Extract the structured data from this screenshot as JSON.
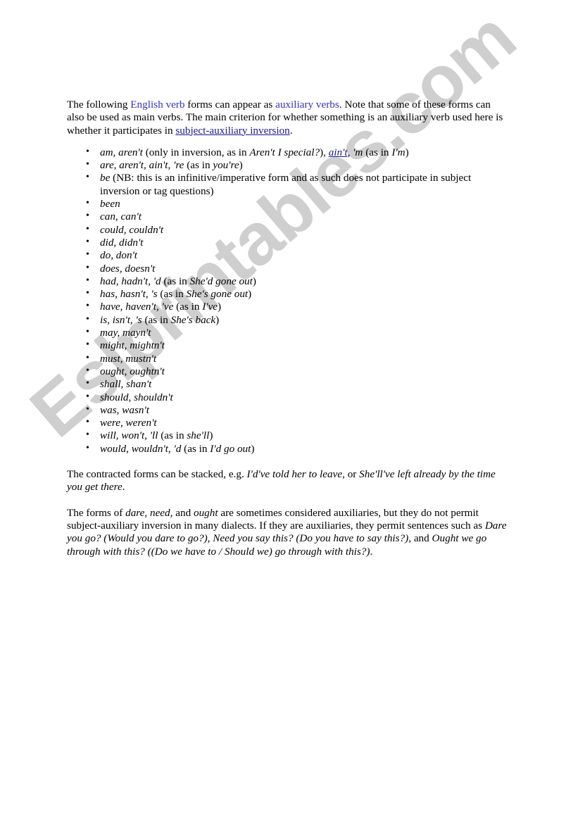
{
  "document": {
    "watermark": "Eslprintables.com",
    "link_color": "#3333bb",
    "link_underlined_color": "#1a1a8c",
    "watermark_color": "#cfcfcf"
  },
  "intro_paragraph": {
    "seg1": "The following ",
    "link1": "English verb",
    "seg2": " forms can appear as ",
    "link2": "auxiliary verbs",
    "seg3": ". Note that some of these forms can also be used as main verbs. The main criterion for whether something is an auxiliary verb used here is whether it participates in ",
    "link3": "subject-auxiliary inversion",
    "seg4": "."
  },
  "list": {
    "items": [
      {
        "id": "am",
        "parts": [
          {
            "t": "am, aren't",
            "style": "italic"
          },
          {
            "t": " (only in inversion, as in ",
            "style": "normal"
          },
          {
            "t": "Aren't I special?",
            "style": "italic"
          },
          {
            "t": "), ",
            "style": "normal"
          },
          {
            "t": "ain't",
            "style": "italic-link"
          },
          {
            "t": ", ",
            "style": "normal"
          },
          {
            "t": "'m",
            "style": "italic"
          },
          {
            "t": " (as in ",
            "style": "normal"
          },
          {
            "t": "I'm",
            "style": "italic"
          },
          {
            "t": ")",
            "style": "normal"
          }
        ]
      },
      {
        "id": "are",
        "parts": [
          {
            "t": "are, aren't, ain't, 're",
            "style": "italic"
          },
          {
            "t": " (as in ",
            "style": "normal"
          },
          {
            "t": "you're",
            "style": "italic"
          },
          {
            "t": ")",
            "style": "normal"
          }
        ]
      },
      {
        "id": "be",
        "parts": [
          {
            "t": "be",
            "style": "italic"
          },
          {
            "t": " (NB: this is an infinitive/imperative form and as such does not participate in subject inversion or tag questions)",
            "style": "normal"
          }
        ]
      },
      {
        "id": "been",
        "parts": [
          {
            "t": "been",
            "style": "italic"
          }
        ]
      },
      {
        "id": "can",
        "parts": [
          {
            "t": "can, can't",
            "style": "italic"
          }
        ]
      },
      {
        "id": "could",
        "parts": [
          {
            "t": "could, couldn't",
            "style": "italic"
          }
        ]
      },
      {
        "id": "did",
        "parts": [
          {
            "t": "did, didn't",
            "style": "italic"
          }
        ]
      },
      {
        "id": "do",
        "parts": [
          {
            "t": "do, don't",
            "style": "italic"
          }
        ]
      },
      {
        "id": "does",
        "parts": [
          {
            "t": "does, doesn't",
            "style": "italic"
          }
        ]
      },
      {
        "id": "had",
        "parts": [
          {
            "t": "had, hadn't, 'd",
            "style": "italic"
          },
          {
            "t": " (as in ",
            "style": "normal"
          },
          {
            "t": "She'd gone out",
            "style": "italic"
          },
          {
            "t": ")",
            "style": "normal"
          }
        ]
      },
      {
        "id": "has",
        "parts": [
          {
            "t": "has, hasn't, 's",
            "style": "italic"
          },
          {
            "t": " (as in ",
            "style": "normal"
          },
          {
            "t": "She's gone out",
            "style": "italic"
          },
          {
            "t": ")",
            "style": "normal"
          }
        ]
      },
      {
        "id": "have",
        "parts": [
          {
            "t": "have, haven't, 've",
            "style": "italic"
          },
          {
            "t": " (as in ",
            "style": "normal"
          },
          {
            "t": "I've",
            "style": "italic"
          },
          {
            "t": ")",
            "style": "normal"
          }
        ]
      },
      {
        "id": "is",
        "parts": [
          {
            "t": "is, isn't, 's",
            "style": "italic"
          },
          {
            "t": " (as in ",
            "style": "normal"
          },
          {
            "t": "She's back",
            "style": "italic"
          },
          {
            "t": ")",
            "style": "normal"
          }
        ]
      },
      {
        "id": "may",
        "parts": [
          {
            "t": "may, mayn't",
            "style": "italic"
          }
        ]
      },
      {
        "id": "might",
        "parts": [
          {
            "t": "might, mightn't",
            "style": "italic"
          }
        ]
      },
      {
        "id": "must",
        "parts": [
          {
            "t": "must, mustn't",
            "style": "italic"
          }
        ]
      },
      {
        "id": "ought",
        "parts": [
          {
            "t": "ought, oughtn't",
            "style": "italic"
          }
        ]
      },
      {
        "id": "shall",
        "parts": [
          {
            "t": "shall, shan't",
            "style": "italic"
          }
        ]
      },
      {
        "id": "should",
        "parts": [
          {
            "t": "should, shouldn't",
            "style": "italic"
          }
        ]
      },
      {
        "id": "was",
        "parts": [
          {
            "t": "was, wasn't",
            "style": "italic"
          }
        ]
      },
      {
        "id": "were",
        "parts": [
          {
            "t": "were, weren't",
            "style": "italic"
          }
        ]
      },
      {
        "id": "will",
        "parts": [
          {
            "t": "will, won't, 'll",
            "style": "italic"
          },
          {
            "t": " (as in ",
            "style": "normal"
          },
          {
            "t": "she'll",
            "style": "italic"
          },
          {
            "t": ")",
            "style": "normal"
          }
        ]
      },
      {
        "id": "would",
        "parts": [
          {
            "t": "would, wouldn't, 'd",
            "style": "italic"
          },
          {
            "t": " (as in ",
            "style": "normal"
          },
          {
            "t": "I'd go out",
            "style": "italic"
          },
          {
            "t": ")",
            "style": "normal"
          }
        ]
      }
    ]
  },
  "stacking_paragraph": {
    "parts": [
      {
        "t": "The contracted forms can be stacked, e.g. ",
        "style": "normal"
      },
      {
        "t": "I'd've told her to leave",
        "style": "italic"
      },
      {
        "t": ", or ",
        "style": "normal"
      },
      {
        "t": "She'll've left already by the time you get there",
        "style": "italic"
      },
      {
        "t": ".",
        "style": "normal"
      }
    ]
  },
  "dare_need_ought_paragraph": {
    "parts": [
      {
        "t": "The forms of ",
        "style": "normal"
      },
      {
        "t": "dare",
        "style": "italic"
      },
      {
        "t": ", ",
        "style": "normal"
      },
      {
        "t": "need",
        "style": "italic"
      },
      {
        "t": ", and ",
        "style": "normal"
      },
      {
        "t": "ought",
        "style": "italic"
      },
      {
        "t": " are sometimes considered auxiliaries, but they do not permit subject-auxiliary inversion in many dialects. If they are auxiliaries, they permit sentences such as ",
        "style": "normal"
      },
      {
        "t": "Dare you go? (Would you dare to go?), Need you say this? (Do you have to say this?)",
        "style": "italic"
      },
      {
        "t": ", and ",
        "style": "normal"
      },
      {
        "t": "Ought we go through with this? ((Do we have to / Should we) go through with this?)",
        "style": "italic"
      },
      {
        "t": ".",
        "style": "normal"
      }
    ]
  }
}
